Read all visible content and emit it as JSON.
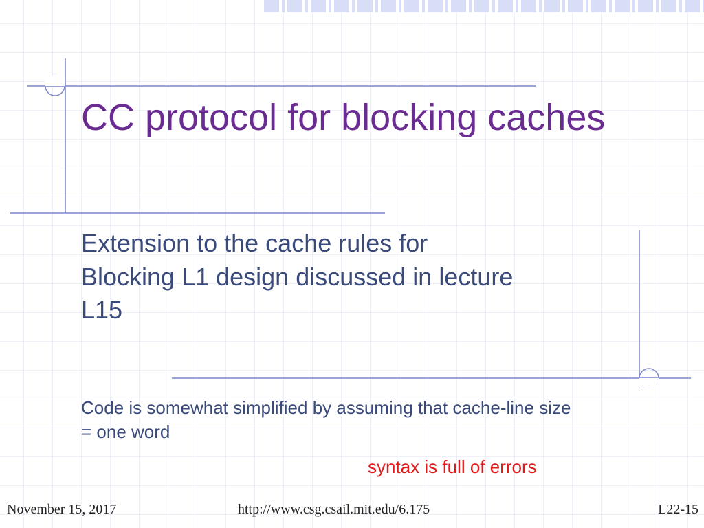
{
  "title": "CC protocol for blocking caches",
  "subtitle": "Extension to the cache rules for Blocking L1 design discussed in lecture L15",
  "note": "Code is somewhat simplified by assuming that cache-line size = one word",
  "warning": "syntax is full of errors",
  "footer": {
    "date": "November 15, 2017",
    "url": "http://www.csg.csail.mit.edu/6.175",
    "page": "L22-15"
  },
  "colors": {
    "title": "#6A2C91",
    "body": "#3A4A7A",
    "warning": "#E11919",
    "rule": "#7A87C7",
    "grid": "#D9DEF7"
  }
}
